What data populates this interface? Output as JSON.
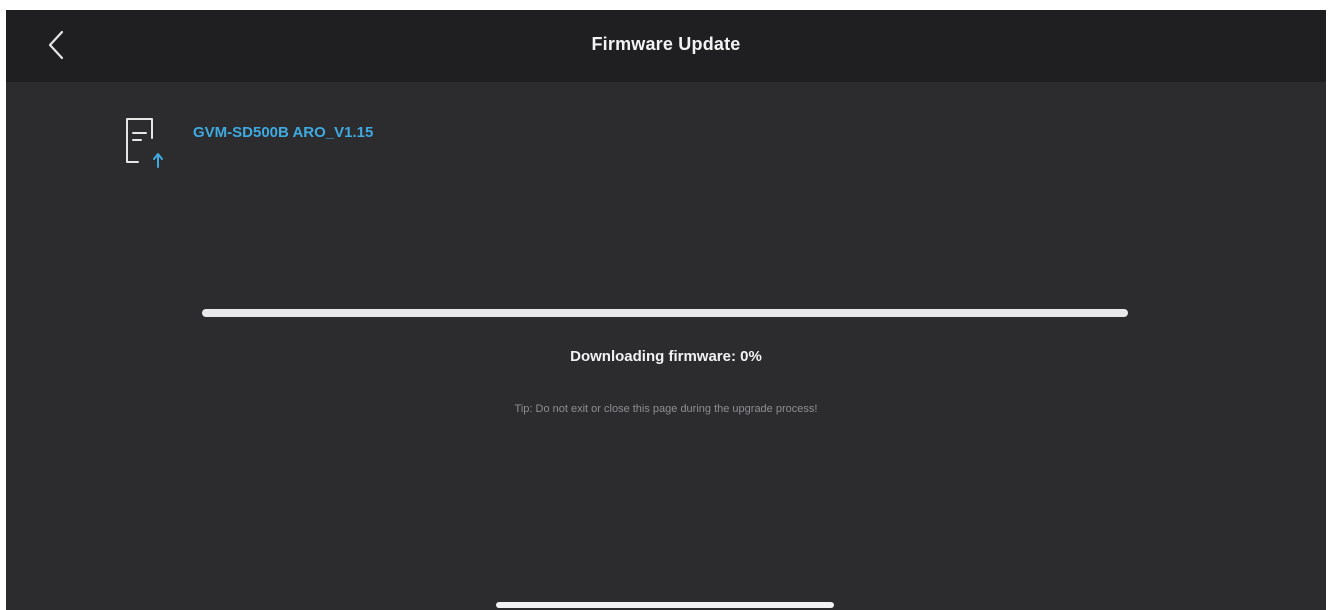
{
  "header": {
    "title": "Firmware Update",
    "back_icon": "chevron-left-icon"
  },
  "firmware": {
    "file_name": "GVM-SD500B ARO_V1.15",
    "icon": "document-upload-icon"
  },
  "progress": {
    "percent": 0,
    "status_label": "Downloading firmware: 0%",
    "tip": "Tip: Do not exit or close this page during the upgrade process!"
  },
  "colors": {
    "background": "#2c2c2e",
    "navbar": "#1f1f21",
    "accent": "#3fa9e0",
    "track": "#e9e9ea",
    "tip_text": "#8e8e93"
  }
}
